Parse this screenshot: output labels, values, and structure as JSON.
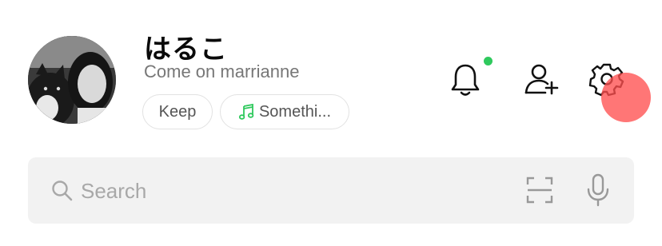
{
  "profile": {
    "name": "はるこ",
    "status_message": "Come on marrianne",
    "chips": [
      {
        "label": "Keep"
      },
      {
        "label": "Somethi...",
        "icon": "music-note-icon",
        "icon_color": "#2fc95d"
      }
    ]
  },
  "header_actions": {
    "notifications": {
      "icon": "bell-icon",
      "has_unread_dot": true,
      "dot_color": "#2fc95d"
    },
    "add_friend": {
      "icon": "add-friend-icon"
    },
    "settings": {
      "icon": "gear-icon"
    }
  },
  "search": {
    "placeholder": "Search",
    "scan_icon": "qr-scan-icon",
    "voice_icon": "microphone-icon"
  },
  "colors": {
    "accent_green": "#2fc95d",
    "touch_indicator": "#ff5050"
  }
}
